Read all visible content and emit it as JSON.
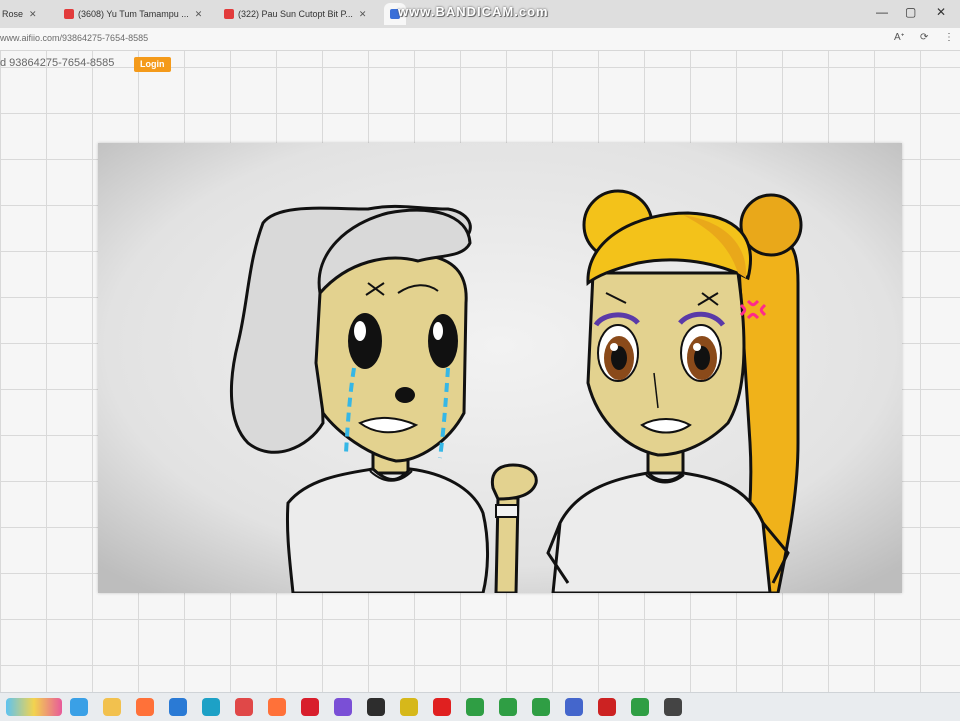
{
  "browser": {
    "tabs": [
      {
        "label": "Rose",
        "color": "#4a7bd6"
      },
      {
        "label": "(3608) Yu Tum Tamampu ...",
        "color": "#e23b3b"
      },
      {
        "label": "(322) Pau Sun Cutopt Bit P...",
        "color": "#e23b3b"
      },
      {
        "label": "",
        "color": "#3a6fd8"
      }
    ],
    "watermark": "www.BANDICAM.com",
    "url": "www.aifiio.com/93864275-7654-8585",
    "toolbar_icons": [
      "read-aloud-icon",
      "refresh-icon",
      "more-icon"
    ]
  },
  "page": {
    "id_text": "d 93864275-7654-8585",
    "login_label": "Login"
  },
  "taskbar": {
    "items": [
      {
        "name": "widgets-icon",
        "color": "#3aa0e6",
        "glyph": ""
      },
      {
        "name": "file-explorer-icon",
        "color": "#f2c14e",
        "glyph": ""
      },
      {
        "name": "firefox-icon",
        "color": "#ff7139",
        "glyph": ""
      },
      {
        "name": "store-icon",
        "color": "#2a7ad5",
        "glyph": ""
      },
      {
        "name": "edge-icon",
        "color": "#1da1c6",
        "glyph": ""
      },
      {
        "name": "app-icon",
        "color": "#e04848",
        "glyph": ""
      },
      {
        "name": "firefox-icon-2",
        "color": "#ff7139",
        "glyph": ""
      },
      {
        "name": "opera-icon",
        "color": "#d81e2c",
        "glyph": ""
      },
      {
        "name": "app-icon-2",
        "color": "#7a4fd6",
        "glyph": ""
      },
      {
        "name": "app-icon-3",
        "color": "#2d2d2d",
        "glyph": ""
      },
      {
        "name": "app-icon-4",
        "color": "#d6b81a",
        "glyph": ""
      },
      {
        "name": "youtube-icon",
        "color": "#e02020",
        "glyph": ""
      },
      {
        "name": "chrome-icon",
        "color": "#2f9e44",
        "glyph": ""
      },
      {
        "name": "chrome-icon-2",
        "color": "#2f9e44",
        "glyph": ""
      },
      {
        "name": "chrome-icon-3",
        "color": "#2f9e44",
        "glyph": ""
      },
      {
        "name": "app-icon-5",
        "color": "#4466cc",
        "glyph": ""
      },
      {
        "name": "record-icon",
        "color": "#cc2222",
        "glyph": ""
      },
      {
        "name": "chrome-icon-4",
        "color": "#2f9e44",
        "glyph": ""
      },
      {
        "name": "app-icon-6",
        "color": "#444",
        "glyph": ""
      }
    ]
  },
  "colors": {
    "accent": "#f49a1a",
    "hair_gray": "#d9d9d9",
    "hair_blonde": "#f3c21a",
    "skin": "#e3d28f",
    "tears": "#36b7e6",
    "anger_mark": "#ff2a8a"
  }
}
